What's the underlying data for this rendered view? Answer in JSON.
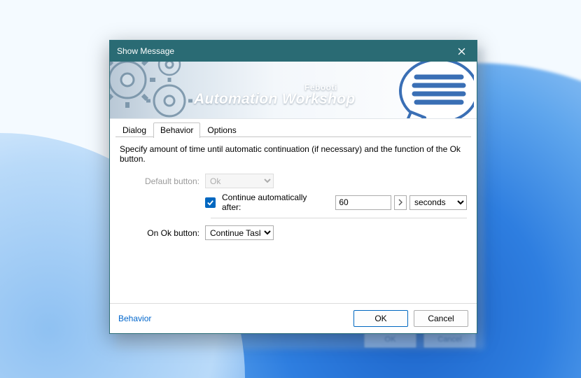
{
  "bg_echo": {
    "ok": "OK",
    "cancel": "Cancel"
  },
  "dialog": {
    "title": "Show Message",
    "banner": {
      "brand_small": "Febooti",
      "brand_big": "Automation Workshop"
    },
    "tabs": [
      {
        "id": "dialog",
        "label": "Dialog",
        "active": false
      },
      {
        "id": "behavior",
        "label": "Behavior",
        "active": true
      },
      {
        "id": "options",
        "label": "Options",
        "active": false
      }
    ],
    "content": {
      "description": "Specify amount of time until automatic continuation (if necessary) and the function of the Ok button.",
      "default_button": {
        "label": "Default button:",
        "value": "Ok",
        "options": [
          "Ok"
        ]
      },
      "continue_auto": {
        "checked": true,
        "label": "Continue automatically after:",
        "value": "60",
        "unit": "seconds",
        "unit_options": [
          "seconds"
        ]
      },
      "on_ok": {
        "label": "On Ok button:",
        "value": "Continue Task",
        "options": [
          "Continue Task"
        ]
      }
    },
    "footer": {
      "link": "Behavior",
      "ok": "OK",
      "cancel": "Cancel"
    }
  }
}
